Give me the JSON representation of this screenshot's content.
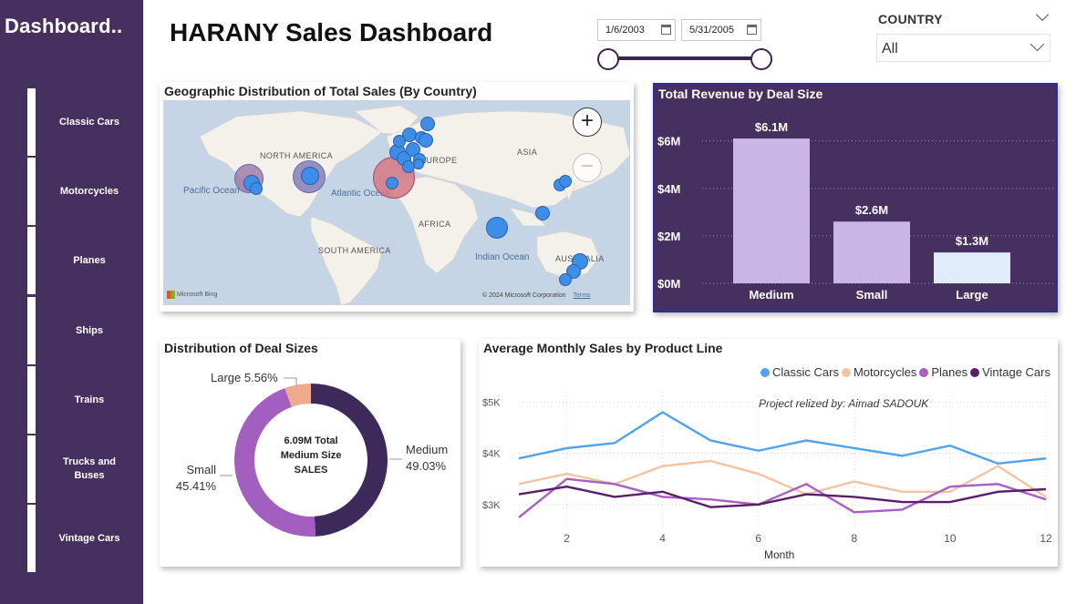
{
  "sidebar": {
    "title": "Dashboard..",
    "items": [
      {
        "label": "Classic Cars"
      },
      {
        "label": "Motorcycles"
      },
      {
        "label": "Planes"
      },
      {
        "label": "Ships"
      },
      {
        "label": "Trains"
      },
      {
        "label": "Trucks and Buses"
      },
      {
        "label": "Vintage Cars"
      }
    ]
  },
  "header": {
    "title": "HARANY Sales Dashboard"
  },
  "date_slicer": {
    "start": "1/6/2003",
    "end": "5/31/2005"
  },
  "country_slicer": {
    "label": "COUNTRY",
    "value": "All"
  },
  "map": {
    "title": "Geographic Distribution of Total Sales (By Country)",
    "labels": {
      "north_america": "NORTH AMERICA",
      "europe": "EUROPE",
      "asia": "ASIA",
      "africa": "AFRICA",
      "south_america": "SOUTH AMERICA",
      "australia": "AUSTRALIA",
      "pacific": "Pacific Ocean",
      "atlantic": "Atlantic Ocean",
      "indian": "Indian Ocean"
    },
    "attribution": "© 2024 Microsoft Corporation",
    "terms": "Terms",
    "brand": "Microsoft Bing"
  },
  "revenue_chart": {
    "title": "Total Revenue by Deal Size",
    "chart_data": {
      "type": "bar",
      "categories": [
        "Medium",
        "Small",
        "Large"
      ],
      "values": [
        6.1,
        2.6,
        1.3
      ],
      "data_labels": [
        "$6.1M",
        "$2.6M",
        "$1.3M"
      ],
      "y_ticks": [
        "$0M",
        "$2M",
        "$4M",
        "$6M"
      ],
      "ylim": [
        0,
        6.6
      ],
      "colors": [
        "#c9b5e6",
        "#c9b5e6",
        "#e0ecfb"
      ]
    }
  },
  "donut_chart": {
    "title": "Distribution of Deal Sizes",
    "center_lines": [
      "6.09M Total",
      "Medium Size",
      "SALES"
    ],
    "chart_data": {
      "type": "pie",
      "categories": [
        "Medium",
        "Small",
        "Large"
      ],
      "values": [
        49.03,
        45.41,
        5.56
      ],
      "colors": [
        "#3d2a5a",
        "#a25fc0",
        "#f0a98a"
      ]
    },
    "labels": {
      "medium_name": "Medium",
      "medium_pct": "49.03%",
      "small_name": "Small",
      "small_pct": "45.41%",
      "large_text": "Large 5.56%"
    }
  },
  "line_chart": {
    "title": "Average Monthly Sales by Product Line",
    "annotation": "Project relized by: Aimad SADOUK",
    "xlabel": "Month",
    "chart_data": {
      "type": "line",
      "x": [
        1,
        2,
        3,
        4,
        5,
        6,
        7,
        8,
        9,
        10,
        11,
        12
      ],
      "x_ticks": [
        "2",
        "4",
        "6",
        "8",
        "10",
        "12"
      ],
      "y_ticks": [
        "$3K",
        "$4K",
        "$5K"
      ],
      "ylim": [
        2500,
        5200
      ],
      "series": [
        {
          "name": "Classic Cars",
          "color": "#4da3f0",
          "values": [
            3900,
            4100,
            4200,
            4800,
            4250,
            4050,
            4250,
            4100,
            3950,
            4150,
            3800,
            3900
          ]
        },
        {
          "name": "Motorcycles",
          "color": "#f2c3a0",
          "values": [
            3400,
            3600,
            3400,
            3750,
            3850,
            3600,
            3200,
            3450,
            3250,
            3250,
            3750,
            3150
          ]
        },
        {
          "name": "Planes",
          "color": "#a85ec2",
          "values": [
            2750,
            3500,
            3400,
            3150,
            3100,
            3000,
            3400,
            2850,
            2900,
            3350,
            3400,
            3100
          ]
        },
        {
          "name": "Vintage Cars",
          "color": "#5a1f6b",
          "values": [
            3200,
            3350,
            3150,
            3250,
            2950,
            3000,
            3200,
            3150,
            3050,
            3050,
            3250,
            3300
          ]
        }
      ]
    }
  }
}
